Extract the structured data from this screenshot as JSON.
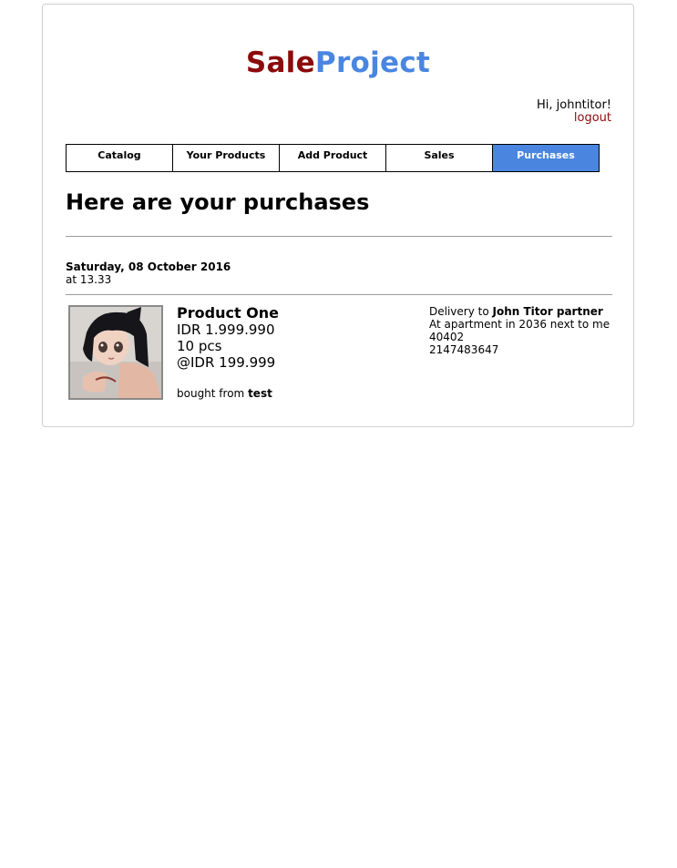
{
  "brand": {
    "part1": "Sale",
    "part2": "Project"
  },
  "user": {
    "greeting": "Hi, johntitor!",
    "logout_label": "logout"
  },
  "nav": {
    "tabs": [
      {
        "label": "Catalog",
        "active": false
      },
      {
        "label": "Your Products",
        "active": false
      },
      {
        "label": "Add Product",
        "active": false
      },
      {
        "label": "Sales",
        "active": false
      },
      {
        "label": "Purchases",
        "active": true
      }
    ]
  },
  "page": {
    "title": "Here are your purchases"
  },
  "purchases": [
    {
      "date": "Saturday, 08 October 2016",
      "time": "at 13.33",
      "product": {
        "name": "Product One",
        "total": "IDR 1.999.990",
        "quantity": "10 pcs",
        "unit_price": "@IDR 199.999",
        "seller_prefix": "bought from",
        "seller": "test"
      },
      "delivery": {
        "prefix": "Delivery to",
        "recipient": "John Titor partner",
        "address": "At apartment in 2036 next to me",
        "postal_code": "40402",
        "phone": "2147483647"
      }
    }
  ],
  "colors": {
    "accent": "#4a86e0",
    "brand_red": "#8b0a0a"
  }
}
